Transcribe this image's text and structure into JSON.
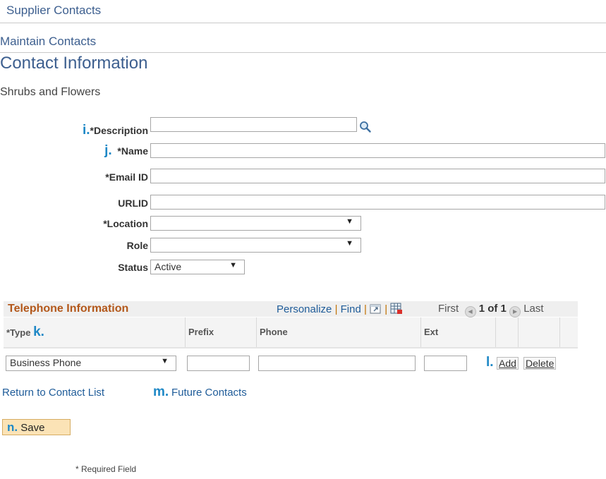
{
  "breadcrumb": "Supplier Contacts",
  "subtitle": "Maintain Contacts",
  "page_title": "Contact Information",
  "supplier_name": "Shrubs and Flowers",
  "form": {
    "description": {
      "marker": "i.",
      "label": "*Description",
      "value": ""
    },
    "name": {
      "marker": "j.",
      "label": "*Name",
      "value": ""
    },
    "email": {
      "label": "*Email ID",
      "value": ""
    },
    "urlid": {
      "label": "URLID",
      "value": ""
    },
    "location": {
      "label": "*Location",
      "value": ""
    },
    "role": {
      "label": "Role",
      "value": ""
    },
    "status": {
      "label": "Status",
      "value": "Active"
    }
  },
  "telephone": {
    "title": "Telephone Information",
    "tools": {
      "personalize": "Personalize",
      "find": "Find",
      "sep": "|"
    },
    "nav": {
      "first": "First",
      "count": "1 of 1",
      "last": "Last"
    },
    "columns": {
      "type": "*Type",
      "type_marker": "k.",
      "prefix": "Prefix",
      "phone": "Phone",
      "ext": "Ext"
    },
    "row": {
      "type": "Business Phone",
      "prefix": "",
      "phone": "",
      "ext": ""
    },
    "add_marker": "l.",
    "add": "Add",
    "delete": "Delete"
  },
  "links": {
    "return": "Return to Contact List",
    "future_marker": "m.",
    "future": "Future Contacts"
  },
  "save": {
    "marker": "n.",
    "label": "Save"
  },
  "required_note": "* Required Field",
  "icons": {
    "lookup": "magnifier-icon",
    "dropdown": "triangle-down-icon",
    "view_all": "zoom-window-icon",
    "download": "spreadsheet-download-icon"
  },
  "colors": {
    "heading": "#3d5f8f",
    "link": "#1f5c99",
    "grid_title": "#b3581b",
    "marker": "#1e88c6",
    "save_button": "#fbe3b6"
  }
}
